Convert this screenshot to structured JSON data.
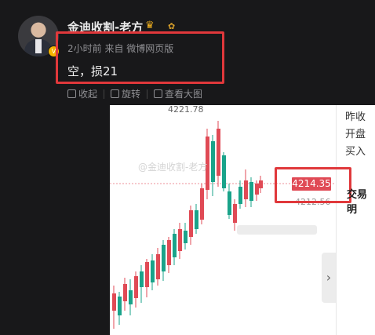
{
  "user": {
    "name": "金迪收割-老方",
    "crown_icon": "crown-icon",
    "badge_icon": "verified-badge-icon"
  },
  "post": {
    "meta": "2小时前  来自  微博网页版",
    "text": "空，损21"
  },
  "actions": [
    {
      "label": "收起",
      "icon": "collapse-icon"
    },
    {
      "label": "旋转",
      "icon": "rotate-icon"
    },
    {
      "label": "查看大图",
      "icon": "view-large-icon"
    }
  ],
  "chart": {
    "high_label": "4221.78",
    "current_price": "4214.35",
    "sub_price": "4212.56",
    "watermark": "@金迪收割-老方",
    "right_labels": [
      "昨收",
      "开盘",
      "买入"
    ],
    "trade_label": "交易明"
  },
  "colors": {
    "up": "#e04a55",
    "down": "#1aa38a",
    "highlight_box": "#e0383b"
  }
}
